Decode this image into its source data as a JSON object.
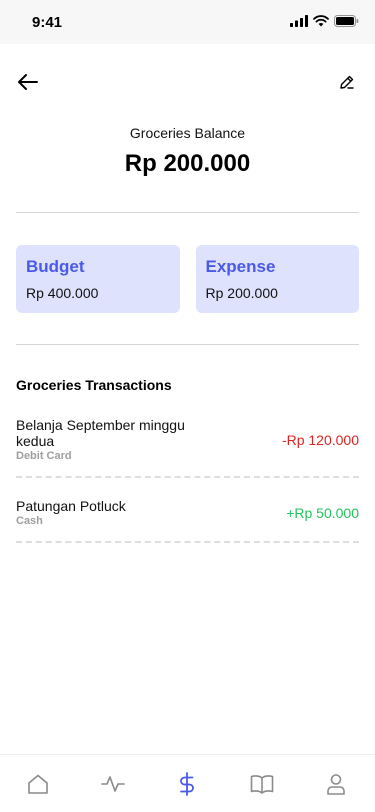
{
  "status_bar": {
    "time": "9:41"
  },
  "header": {
    "back_icon": "arrow-left-icon",
    "edit_icon": "pencil-icon"
  },
  "balance": {
    "label": "Groceries Balance",
    "value": "Rp 200.000"
  },
  "cards": [
    {
      "title": "Budget",
      "value": "Rp 400.000"
    },
    {
      "title": "Expense",
      "value": "Rp 200.000"
    }
  ],
  "transactions": {
    "title": "Groceries Transactions",
    "items": [
      {
        "title": "Belanja September minggu kedua",
        "method": "Debit Card",
        "amount": "-Rp 120.000",
        "type": "negative"
      },
      {
        "title": "Patungan Potluck",
        "method": "Cash",
        "amount": "+Rp 50.000",
        "type": "positive"
      }
    ]
  },
  "bottom_nav": {
    "items": [
      "home-icon",
      "activity-icon",
      "dollar-icon",
      "book-icon",
      "user-icon"
    ],
    "active": "dollar-icon"
  },
  "colors": {
    "accent": "#4a5ae8",
    "card_bg": "#dfe2fd",
    "negative": "#e02424",
    "positive": "#22c55e",
    "inactive_icon": "#8a8a8a"
  }
}
